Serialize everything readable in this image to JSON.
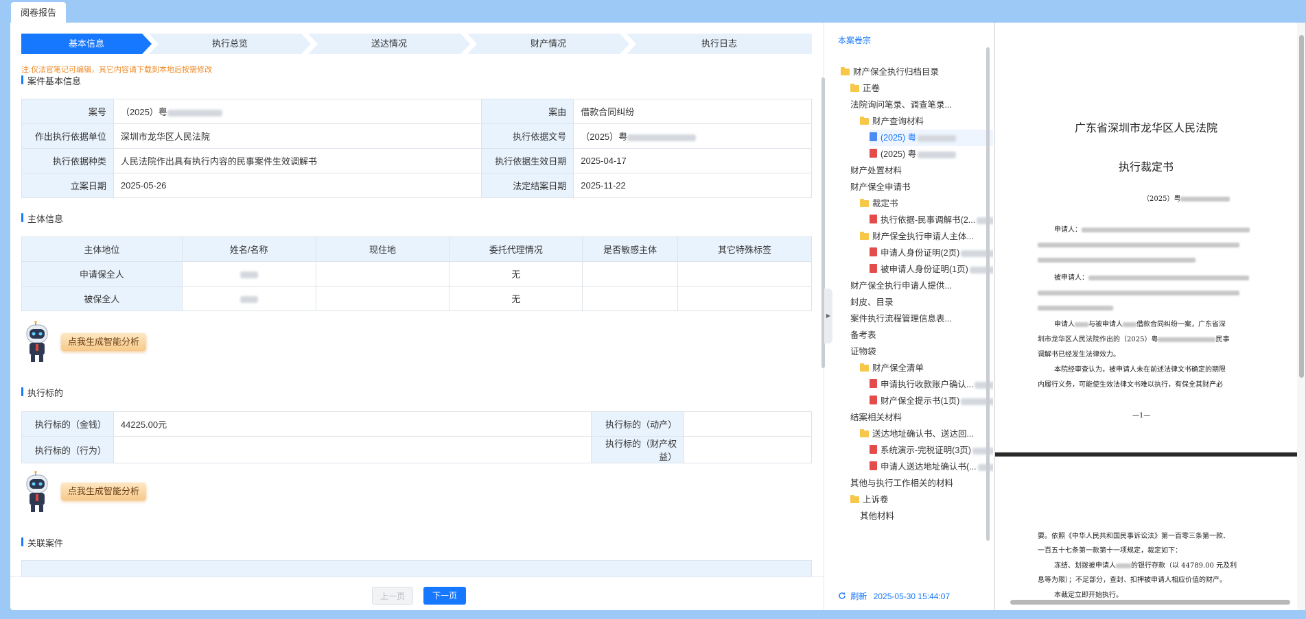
{
  "window": {
    "tab_label": "阅卷报告"
  },
  "steps": [
    "基本信息",
    "执行总览",
    "送达情况",
    "财产情况",
    "执行日志"
  ],
  "note": "注:仅法官笔记可编辑，其它内容请下载到本地后按需修改",
  "case_info": {
    "title": "案件基本信息",
    "rows": [
      {
        "l1": "案号",
        "v1": "（2025）粤",
        "l2": "案由",
        "v2": "借款合同纠纷"
      },
      {
        "l1": "作出执行依据单位",
        "v1": "深圳市龙华区人民法院",
        "l2": "执行依据文号",
        "v2": "（2025）粤"
      },
      {
        "l1": "执行依据种类",
        "v1": "人民法院作出具有执行内容的民事案件生效调解书",
        "l2": "执行依据生效日期",
        "v2": "2025-04-17"
      },
      {
        "l1": "立案日期",
        "v1": "2025-05-26",
        "l2": "法定结案日期",
        "v2": "2025-11-22"
      }
    ]
  },
  "party_info": {
    "title": "主体信息",
    "headers": [
      "主体地位",
      "姓名/名称",
      "现住地",
      "委托代理情况",
      "是否敏感主体",
      "其它特殊标签"
    ],
    "rows": [
      {
        "role": "申请保全人",
        "agent": "无"
      },
      {
        "role": "被保全人",
        "agent": "无"
      }
    ]
  },
  "ai_button": "点我生成智能分析",
  "target_info": {
    "title": "执行标的",
    "money_label": "执行标的（金钱）",
    "money_value": "44225.00元",
    "movable_label": "执行标的（动产）",
    "behavior_label": "执行标的（行为）",
    "property_label": "执行标的（财产权益）"
  },
  "related": {
    "title": "关联案件"
  },
  "pager": {
    "prev": "上一页",
    "next": "下一页"
  },
  "tree": {
    "title": "本案卷宗",
    "items": [
      {
        "label": "财产保全执行归档目录",
        "type": "folder"
      },
      {
        "label": "正卷",
        "type": "folder"
      },
      {
        "label": "法院询问笔录、调查笔录...",
        "type": "text"
      },
      {
        "label": "财产查询材料",
        "type": "folder"
      },
      {
        "label": "(2025) 粤",
        "type": "doc"
      },
      {
        "label": "(2025) 粤",
        "type": "pdf"
      },
      {
        "label": "财产处置材料",
        "type": "text"
      },
      {
        "label": "财产保全申请书",
        "type": "text"
      },
      {
        "label": "裁定书",
        "type": "folder"
      },
      {
        "label": "执行依据-民事调解书(2...",
        "type": "pdf"
      },
      {
        "label": "财产保全执行申请人主体...",
        "type": "folder"
      },
      {
        "label": "申请人身份证明(2页)",
        "type": "pdf"
      },
      {
        "label": "被申请人身份证明(1页)",
        "type": "pdf"
      },
      {
        "label": "财产保全执行申请人提供...",
        "type": "text"
      },
      {
        "label": "封皮、目录",
        "type": "text"
      },
      {
        "label": "案件执行流程管理信息表...",
        "type": "text"
      },
      {
        "label": "备考表",
        "type": "text"
      },
      {
        "label": "证物袋",
        "type": "text"
      },
      {
        "label": "财产保全清单",
        "type": "folder"
      },
      {
        "label": "申请执行收款账户确认...",
        "type": "pdf"
      },
      {
        "label": "财产保全提示书(1页)",
        "type": "pdf"
      },
      {
        "label": "结案相关材料",
        "type": "text"
      },
      {
        "label": "送达地址确认书、送达回...",
        "type": "folder"
      },
      {
        "label": "系统演示-完税证明(3页)",
        "type": "pdf"
      },
      {
        "label": "申请人送达地址确认书(...",
        "type": "pdf"
      },
      {
        "label": "其他与执行工作相关的材料",
        "type": "text"
      },
      {
        "label": "上诉卷",
        "type": "folder"
      },
      {
        "label": "其他材料",
        "type": "text"
      }
    ],
    "refresh_label": "刷新",
    "refresh_time": "2025-05-30 15:44:07"
  },
  "preview": {
    "court": "广东省深圳市龙华区人民法院",
    "doc_title": "执行裁定书",
    "case_no": "（2025）粤",
    "applicant_label": "申请人：",
    "respondent_label": "被申请人：",
    "para1a": "申请人",
    "para1b": "与被申请人",
    "para1c": "借款合同纠纷一案，广东省深",
    "para1d": "圳市龙华区人民法院作出的（2025）粤",
    "para1e": "民事",
    "para1f": "调解书已经发生法律效力。",
    "para2a": "本院经审查认为，被申请人未在前述法律文书确定的期限",
    "para2b": "内履行义务，可能使生效法律文书难以执行，有保全其财产必",
    "page_num": "—1—",
    "p2a": "要。依照《中华人民共和国民事诉讼法》第一百零三条第一款、",
    "p2b": "一百五十七条第一款第十一项规定，裁定如下：",
    "p2c": "冻结、划拨被申请人",
    "p2d": "的银行存款（以 44789.00 元及利",
    "p2e": "息等为限）；不足部分，查封、扣押被申请人相应价值的财产。",
    "p2f": "本裁定立即开始执行。"
  }
}
